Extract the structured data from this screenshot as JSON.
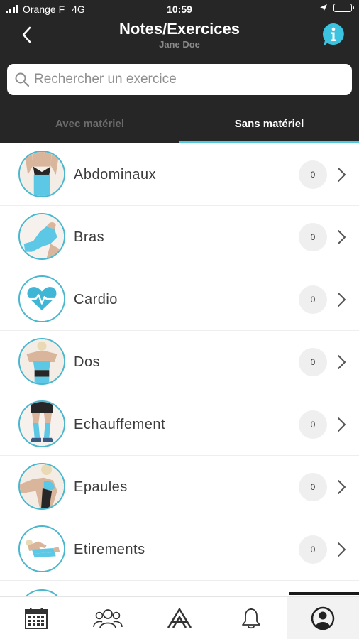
{
  "status_bar": {
    "carrier": "Orange F",
    "network": "4G",
    "time": "10:59"
  },
  "header": {
    "title": "Notes/Exercices",
    "subtitle": "Jane Doe",
    "back_icon": "chevron-left-icon",
    "info_icon": "info-icon"
  },
  "search": {
    "placeholder": "Rechercher un exercice",
    "value": ""
  },
  "tabs": [
    {
      "label": "Avec matériel",
      "active": false
    },
    {
      "label": "Sans matériel",
      "active": true
    }
  ],
  "categories": [
    {
      "label": "Abdominaux",
      "count": "0"
    },
    {
      "label": "Bras",
      "count": "0"
    },
    {
      "label": "Cardio",
      "count": "0"
    },
    {
      "label": "Dos",
      "count": "0"
    },
    {
      "label": "Echauffement",
      "count": "0"
    },
    {
      "label": "Epaules",
      "count": "0"
    },
    {
      "label": "Etirements",
      "count": "0"
    }
  ],
  "bottom_nav": [
    {
      "icon": "calendar-icon"
    },
    {
      "icon": "group-icon"
    },
    {
      "icon": "logo-icon"
    },
    {
      "icon": "bell-icon"
    },
    {
      "icon": "profile-icon",
      "selected": true
    }
  ],
  "colors": {
    "header_bg": "#262626",
    "accent": "#4fc8de",
    "avatar_border": "#4ab7cf",
    "count_bg": "#efefef"
  }
}
